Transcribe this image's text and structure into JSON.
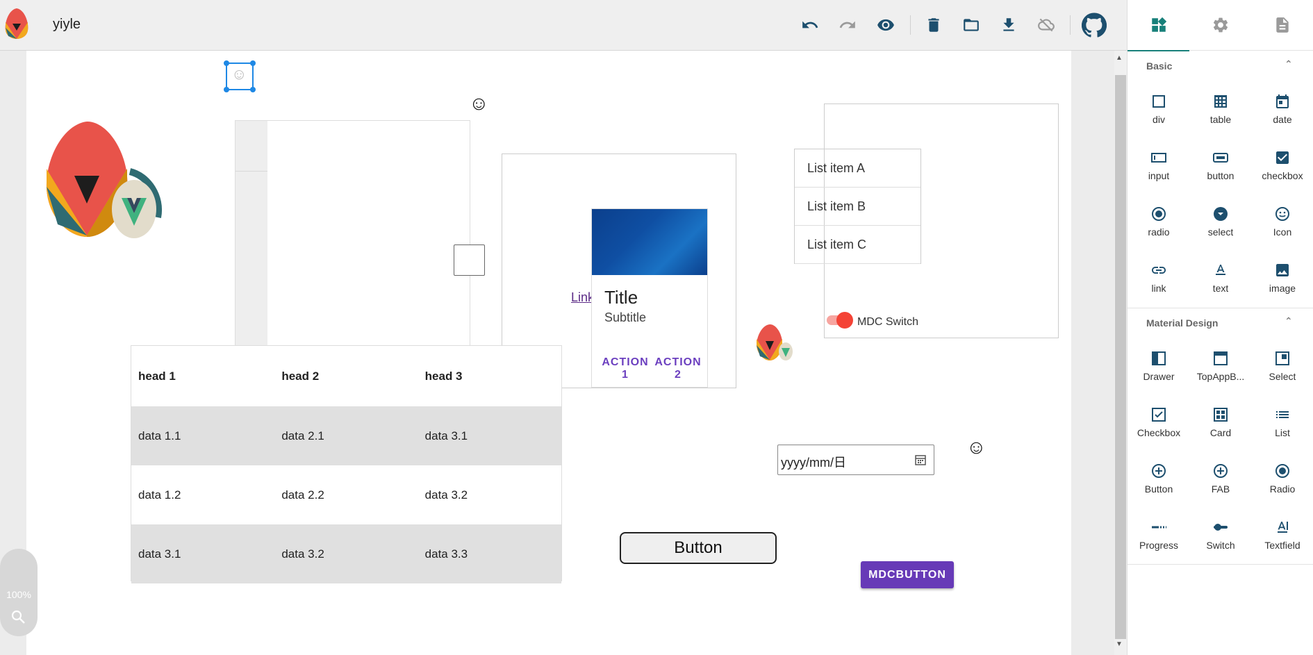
{
  "app": {
    "title": "yiyle"
  },
  "toolbar": {
    "icons": [
      "undo-icon",
      "redo-icon",
      "preview-icon",
      "delete-icon",
      "folder-icon",
      "download-icon",
      "cloud-off-icon",
      "github-icon"
    ]
  },
  "side_tabs": [
    "components-icon",
    "settings-icon",
    "page-icon"
  ],
  "basic": {
    "title": "Basic",
    "items": [
      "div",
      "table",
      "date",
      "input",
      "button",
      "checkbox",
      "radio",
      "select",
      "Icon",
      "link",
      "text",
      "image"
    ]
  },
  "material": {
    "title": "Material Design",
    "items": [
      "Drawer",
      "TopAppB...",
      "Select",
      "Checkbox",
      "Card",
      "List",
      "Button",
      "FAB",
      "Radio",
      "Progress",
      "Switch",
      "Textfield"
    ]
  },
  "canvas": {
    "table": {
      "headers": [
        "head 1",
        "head 2",
        "head 3"
      ],
      "rows": [
        [
          "data 1.1",
          "data 2.1",
          "data 3.1"
        ],
        [
          "data 1.2",
          "data 2.2",
          "data 3.2"
        ],
        [
          "data 3.1",
          "data 3.2",
          "data 3.3"
        ]
      ]
    },
    "list": [
      "List item A",
      "List item B",
      "List item C"
    ],
    "card": {
      "title": "Title",
      "subtitle": "Subtitle",
      "action1": "ACTION 1",
      "action2": "ACTION 2"
    },
    "link": "Link",
    "switch_label": "MDC Switch",
    "date_placeholder": "yyyy/mm/日",
    "button_label": "Button",
    "mdc_button_label": "MDCBUTTON"
  },
  "zoom": {
    "level": "100%"
  },
  "colors": {
    "accent": "#18807a",
    "mdc": "#673ab7",
    "switch": "#f44336"
  }
}
